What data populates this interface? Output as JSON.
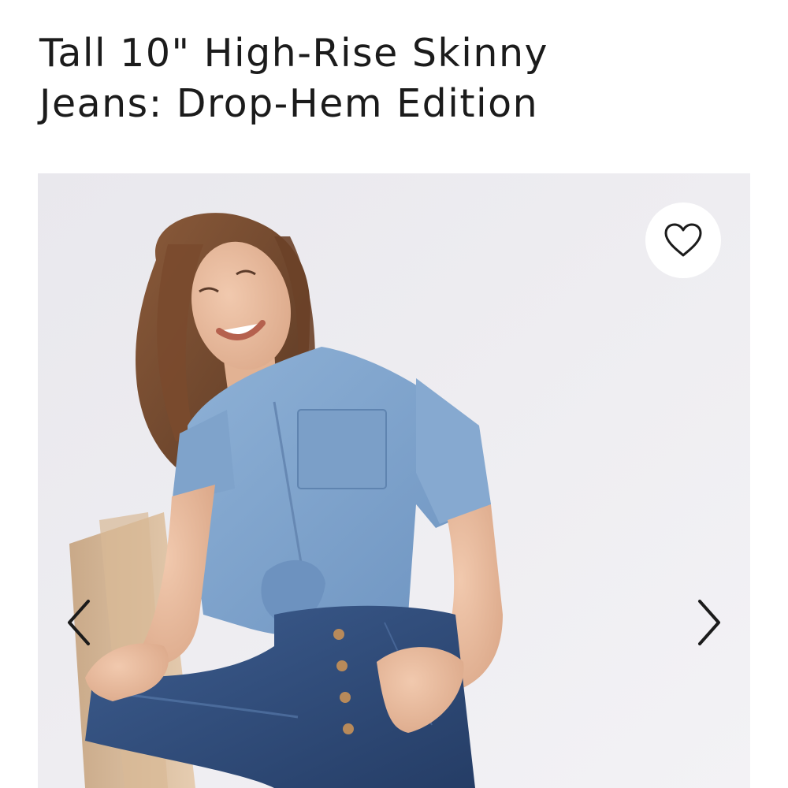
{
  "product": {
    "title_line1": "Tall 10\" High-Rise Skinny",
    "title_line2": "Jeans: Drop-Hem Edition"
  },
  "gallery": {
    "image_subject": "model wearing chambray tied shirt and dark-wash skinny jeans, seated on wooden stool",
    "favorite_icon": "heart-outline-icon",
    "prev_icon": "chevron-left-icon",
    "next_icon": "chevron-right-icon"
  },
  "colors": {
    "text": "#1b1b1b",
    "background": "#ffffff",
    "photo_backdrop": "#eeedf0",
    "denim_shirt": "#7fa3cb",
    "denim_jeans": "#2f4a78"
  }
}
